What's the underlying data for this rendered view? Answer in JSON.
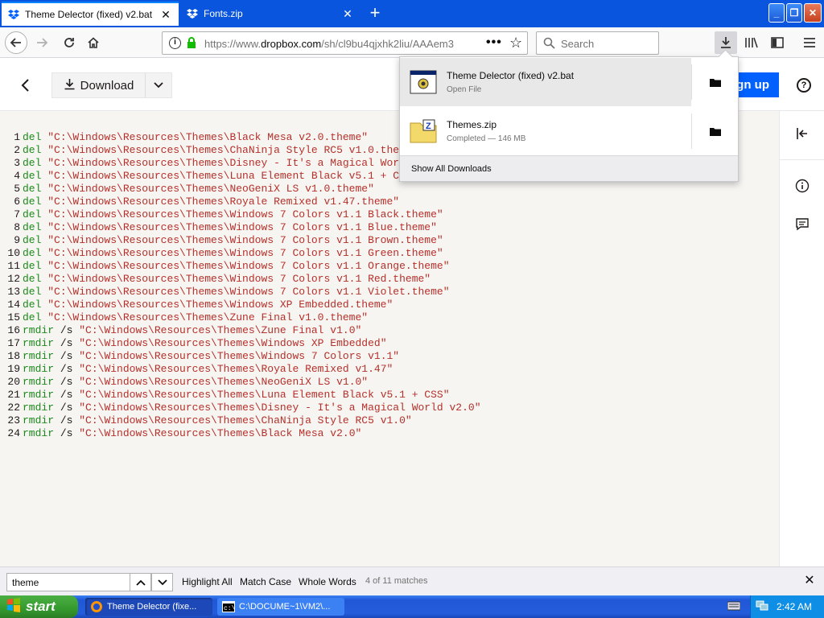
{
  "browser": {
    "tabs": [
      {
        "title": "Theme Delector (fixed) v2.bat",
        "active": true
      },
      {
        "title": "Fonts.zip",
        "active": false
      }
    ],
    "url_prefix": "https://www.",
    "url_domain": "dropbox.com",
    "url_path": "/sh/cl9bu4qjxhk2liu/AAAem3",
    "search_placeholder": "Search"
  },
  "dropbox": {
    "download_label": "Download",
    "signup_label": "Sign up",
    "signup_visible": "gn up",
    "help_label": "?"
  },
  "code_lines": [
    {
      "n": "1",
      "cmd": "del",
      "args": "",
      "path": "\"C:\\Windows\\Resources\\Themes\\Black Mesa v2.0.theme\""
    },
    {
      "n": "2",
      "cmd": "del",
      "args": "",
      "path": "\"C:\\Windows\\Resources\\Themes\\ChaNinja Style RC5 v1.0.theme\""
    },
    {
      "n": "3",
      "cmd": "del",
      "args": "",
      "path": "\"C:\\Windows\\Resources\\Themes\\Disney - It's a Magical World v2.0.theme\""
    },
    {
      "n": "4",
      "cmd": "del",
      "args": "",
      "path": "\"C:\\Windows\\Resources\\Themes\\Luna Element Black v5.1 + CSS.theme\""
    },
    {
      "n": "5",
      "cmd": "del",
      "args": "",
      "path": "\"C:\\Windows\\Resources\\Themes\\NeoGeniX LS v1.0.theme\""
    },
    {
      "n": "6",
      "cmd": "del",
      "args": "",
      "path": "\"C:\\Windows\\Resources\\Themes\\Royale Remixed v1.47.theme\""
    },
    {
      "n": "7",
      "cmd": "del",
      "args": "",
      "path": "\"C:\\Windows\\Resources\\Themes\\Windows 7 Colors v1.1 Black.theme\""
    },
    {
      "n": "8",
      "cmd": "del",
      "args": "",
      "path": "\"C:\\Windows\\Resources\\Themes\\Windows 7 Colors v1.1 Blue.theme\""
    },
    {
      "n": "9",
      "cmd": "del",
      "args": "",
      "path": "\"C:\\Windows\\Resources\\Themes\\Windows 7 Colors v1.1 Brown.theme\""
    },
    {
      "n": "10",
      "cmd": "del",
      "args": "",
      "path": "\"C:\\Windows\\Resources\\Themes\\Windows 7 Colors v1.1 Green.theme\""
    },
    {
      "n": "11",
      "cmd": "del",
      "args": "",
      "path": "\"C:\\Windows\\Resources\\Themes\\Windows 7 Colors v1.1 Orange.theme\""
    },
    {
      "n": "12",
      "cmd": "del",
      "args": "",
      "path": "\"C:\\Windows\\Resources\\Themes\\Windows 7 Colors v1.1 Red.theme\""
    },
    {
      "n": "13",
      "cmd": "del",
      "args": "",
      "path": "\"C:\\Windows\\Resources\\Themes\\Windows 7 Colors v1.1 Violet.theme\""
    },
    {
      "n": "14",
      "cmd": "del",
      "args": "",
      "path": "\"C:\\Windows\\Resources\\Themes\\Windows XP Embedded.theme\""
    },
    {
      "n": "15",
      "cmd": "del",
      "args": "",
      "path": "\"C:\\Windows\\Resources\\Themes\\Zune Final v1.0.theme\""
    },
    {
      "n": "16",
      "cmd": "rmdir",
      "args": " /s ",
      "path": "\"C:\\Windows\\Resources\\Themes\\Zune Final v1.0\""
    },
    {
      "n": "17",
      "cmd": "rmdir",
      "args": " /s ",
      "path": "\"C:\\Windows\\Resources\\Themes\\Windows XP Embedded\""
    },
    {
      "n": "18",
      "cmd": "rmdir",
      "args": " /s ",
      "path": "\"C:\\Windows\\Resources\\Themes\\Windows 7 Colors v1.1\""
    },
    {
      "n": "19",
      "cmd": "rmdir",
      "args": " /s ",
      "path": "\"C:\\Windows\\Resources\\Themes\\Royale Remixed v1.47\""
    },
    {
      "n": "20",
      "cmd": "rmdir",
      "args": " /s ",
      "path": "\"C:\\Windows\\Resources\\Themes\\NeoGeniX LS v1.0\""
    },
    {
      "n": "21",
      "cmd": "rmdir",
      "args": " /s ",
      "path": "\"C:\\Windows\\Resources\\Themes\\Luna Element Black v5.1 + CSS\""
    },
    {
      "n": "22",
      "cmd": "rmdir",
      "args": " /s ",
      "path": "\"C:\\Windows\\Resources\\Themes\\Disney - It's a Magical World v2.0\""
    },
    {
      "n": "23",
      "cmd": "rmdir",
      "args": " /s ",
      "path": "\"C:\\Windows\\Resources\\Themes\\ChaNinja Style RC5 v1.0\""
    },
    {
      "n": "24",
      "cmd": "rmdir",
      "args": " /s ",
      "path": "\"C:\\Windows\\Resources\\Themes\\Black Mesa v2.0\""
    }
  ],
  "downloads_panel": {
    "items": [
      {
        "name": "Theme Delector (fixed) v2.bat",
        "status": "Open File"
      },
      {
        "name": "Themes.zip",
        "status": "Completed — 146 MB"
      }
    ],
    "show_all": "Show All Downloads"
  },
  "findbar": {
    "query": "theme",
    "highlight_all": "Highlight All",
    "match_case": "Match Case",
    "whole_words": "Whole Words",
    "count": "4 of 11 matches"
  },
  "taskbar": {
    "start": "start",
    "tasks": [
      {
        "label": "Theme Delector (fixe..."
      },
      {
        "label": "C:\\DOCUME~1\\VM2\\..."
      }
    ],
    "clock": "2:42 AM"
  },
  "colors": {
    "keyword": "#1a8a1a",
    "string": "#b5302a",
    "dropbox_blue": "#0061fe",
    "tab_bar": "#0a55dd"
  }
}
